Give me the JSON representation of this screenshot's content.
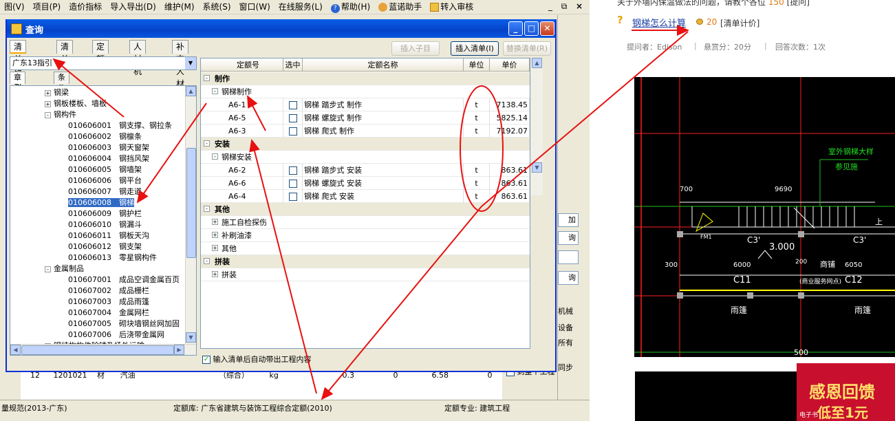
{
  "menubar": {
    "items": [
      "图(V)",
      "项目(P)",
      "造价指标",
      "导入导出(D)",
      "维护(M)",
      "系统(S)",
      "窗口(W)",
      "在线服务(L)",
      "帮助(H)",
      "蓝诺助手",
      "转入审核"
    ]
  },
  "dialog": {
    "title": "查询",
    "tabs": [
      "清单指引",
      "清单",
      "定额",
      "人材机",
      "补充人材机"
    ],
    "buttons": {
      "insert_child": "插入子目",
      "insert_list": "插入清单(I)",
      "replace_list": "替换清单(R)"
    },
    "combo_value": "广东13指引",
    "subtabs": [
      "章节查询",
      "条件查询"
    ],
    "tree": [
      {
        "label": "钢梁",
        "level": 1,
        "exp": "+"
      },
      {
        "label": "钢板楼板、墙板",
        "level": 1,
        "exp": "+"
      },
      {
        "label": "钢构件",
        "level": 1,
        "exp": "-"
      },
      {
        "label": "010606001　钢支撑、钢拉条",
        "level": 2
      },
      {
        "label": "010606002　钢檩条",
        "level": 2
      },
      {
        "label": "010606003　钢天窗架",
        "level": 2
      },
      {
        "label": "010606004　钢挡风架",
        "level": 2
      },
      {
        "label": "010606005　钢墙架",
        "level": 2
      },
      {
        "label": "010606006　钢平台",
        "level": 2
      },
      {
        "label": "010606007　钢走道",
        "level": 2
      },
      {
        "label": "010606008　钢梯",
        "level": 2,
        "selected": true
      },
      {
        "label": "010606009　钢护栏",
        "level": 2
      },
      {
        "label": "010606010　钢漏斗",
        "level": 2
      },
      {
        "label": "010606011　钢板天沟",
        "level": 2
      },
      {
        "label": "010606012　钢支架",
        "level": 2
      },
      {
        "label": "010606013　零星钢构件",
        "level": 2
      },
      {
        "label": "金属制品",
        "level": 1,
        "exp": "-"
      },
      {
        "label": "010607001　成品空调金属百页",
        "level": 2
      },
      {
        "label": "010607002　成品栅栏",
        "level": 2
      },
      {
        "label": "010607003　成品雨篷",
        "level": 2
      },
      {
        "label": "010607004　金属网栏",
        "level": 2
      },
      {
        "label": "010607005　砌块墙钢丝网加固",
        "level": 2
      },
      {
        "label": "010607006　后浇带金属网",
        "level": 2
      },
      {
        "label": "钢结构构件除锈及场外运输",
        "level": 1,
        "exp": "+"
      }
    ],
    "grid": {
      "headers": [
        "定额号",
        "选中",
        "定额名称",
        "单位",
        "单价"
      ],
      "rows": [
        {
          "type": "group",
          "exp": "-",
          "name": "制作"
        },
        {
          "type": "sub",
          "exp": "-",
          "name": "钢梯制作"
        },
        {
          "type": "item",
          "code": "A6-1",
          "name": "钢梯 踏步式 制作",
          "unit": "t",
          "price": "7138.45"
        },
        {
          "type": "item",
          "code": "A6-5",
          "name": "钢梯 螺旋式 制作",
          "unit": "t",
          "price": "5825.14"
        },
        {
          "type": "item",
          "code": "A6-3",
          "name": "钢梯 爬式 制作",
          "unit": "t",
          "price": "7192.07"
        },
        {
          "type": "group",
          "exp": "-",
          "name": "安装"
        },
        {
          "type": "sub",
          "exp": "-",
          "name": "钢梯安装"
        },
        {
          "type": "item",
          "code": "A6-2",
          "name": "钢梯 踏步式 安装",
          "unit": "t",
          "price": "863.61"
        },
        {
          "type": "item",
          "code": "A6-6",
          "name": "钢梯 螺旋式 安装",
          "unit": "t",
          "price": "863.61"
        },
        {
          "type": "item",
          "code": "A6-4",
          "name": "钢梯 爬式 安装",
          "unit": "t",
          "price": "863.61"
        },
        {
          "type": "group",
          "exp": "-",
          "name": "其他"
        },
        {
          "type": "sub",
          "exp": "+",
          "name": "施工自检探伤"
        },
        {
          "type": "sub",
          "exp": "+",
          "name": "补刷油漆"
        },
        {
          "type": "sub",
          "exp": "+",
          "name": "其他"
        },
        {
          "type": "group",
          "exp": "-",
          "name": "拼装"
        },
        {
          "type": "sub",
          "exp": "+",
          "name": "拼装"
        }
      ]
    },
    "auto_check": "输入清单后自动带出工程内容"
  },
  "background": {
    "buttons": [
      "加",
      "询",
      "",
      "询"
    ],
    "checks": [
      "机械",
      "设备",
      "所有"
    ],
    "texts": [
      "同步",
      "到整个工程"
    ],
    "row": {
      "num": "12",
      "code": "1201021",
      "type": "材",
      "name": "汽油",
      "spec": "（综合）",
      "unit": "kg",
      "v1": "0.3",
      "v2": "0",
      "v3": "6.58",
      "v4": "0"
    }
  },
  "statusbar": {
    "left": "量规范(2013-广东)",
    "lib": "定额库: 广东省建筑与装饰工程综合定额(2010)",
    "spec": "定额专业: 建筑工程"
  },
  "qa": {
    "top_text": "关于外墙内保温做法的问题，请教个各位",
    "top_score": "150",
    "top_tag": "[提问]",
    "title": "钢梯怎么计算",
    "score": "20",
    "tag": "[清单计价]",
    "asker": "提问者：Edison",
    "reward": "悬赏分：20分",
    "answers": "回答次数：1次"
  },
  "cad": {
    "labels": [
      "室外钢梯大样",
      "参见施",
      "700",
      "9690",
      "3.000",
      "C3'",
      "C3'",
      "FM1",
      "6000",
      "200",
      "6050",
      "300",
      "C11",
      "商铺",
      "(商业服务网点)",
      "C12",
      "雨篷",
      "雨篷",
      "500",
      "上"
    ]
  },
  "banner": {
    "text1": "感恩回馈",
    "text2": "低至1元",
    "text3": "电子书"
  }
}
